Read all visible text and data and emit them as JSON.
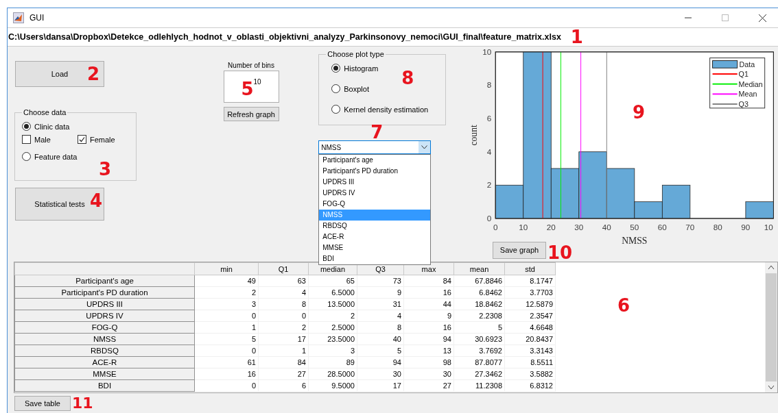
{
  "window": {
    "title": "GUI"
  },
  "path_bar": {
    "text": "C:\\Users\\dansa\\Dropbox\\Detekce_odlehlych_hodnot_v_oblasti_objektivni_analyzy_Parkinsonovy_nemoci\\GUI_final\\feature_matrix.xlsx",
    "callout": "1"
  },
  "load_button": {
    "label": "Load",
    "callout": "2"
  },
  "choose_data": {
    "title": "Choose data",
    "callout": "3",
    "options": [
      {
        "kind": "radio",
        "label": "Clinic data",
        "selected": true
      },
      {
        "kind": "checkbox",
        "label": "Male",
        "checked": false
      },
      {
        "kind": "checkbox",
        "label": "Female",
        "checked": true
      },
      {
        "kind": "radio",
        "label": "Feature data",
        "selected": false
      }
    ]
  },
  "stat_tests_button": {
    "label": "Statistical tests",
    "callout": "4"
  },
  "bins": {
    "label": "Number of bins",
    "value": "10",
    "callout": "5",
    "refresh_label": "Refresh graph"
  },
  "plot_type": {
    "title": "Choose plot type",
    "callout": "8",
    "options": [
      {
        "label": "Histogram",
        "selected": true
      },
      {
        "label": "Boxplot",
        "selected": false
      },
      {
        "label": "Kernel density estimation",
        "selected": false
      }
    ]
  },
  "variable_dropdown": {
    "value": "NMSS",
    "callout": "7",
    "expanded": true,
    "options": [
      {
        "label": "Participant's age",
        "selected": false
      },
      {
        "label": "Participant's PD duration",
        "selected": false
      },
      {
        "label": "UPDRS III",
        "selected": false
      },
      {
        "label": "UPDRS IV",
        "selected": false
      },
      {
        "label": "FOG-Q",
        "selected": false
      },
      {
        "label": "NMSS",
        "selected": true
      },
      {
        "label": "RBDSQ",
        "selected": false
      },
      {
        "label": "ACE-R",
        "selected": false
      },
      {
        "label": "MMSE",
        "selected": false
      },
      {
        "label": "BDI",
        "selected": false
      }
    ]
  },
  "graph": {
    "callout": "9",
    "save_label": "Save graph",
    "save_callout": "10",
    "chart_data": {
      "type": "bar",
      "xlabel": "NMSS",
      "ylabel": "count",
      "x": [
        5,
        15,
        25,
        35,
        45,
        55,
        65,
        75,
        85,
        95
      ],
      "series": [
        {
          "name": "Data",
          "color": "#65a9d7",
          "values": [
            2,
            10,
            3,
            4,
            3,
            1,
            2,
            0,
            0,
            1
          ]
        }
      ],
      "xlim": [
        0,
        100
      ],
      "ylim": [
        0,
        10
      ],
      "xticks": [
        0,
        10,
        20,
        30,
        40,
        50,
        60,
        70,
        80,
        90
      ],
      "yticks": [
        0,
        2,
        4,
        6,
        8,
        10
      ],
      "ref_lines": [
        {
          "axis": "x",
          "value": 17,
          "color": "#ff0000"
        },
        {
          "axis": "x",
          "value": 23.5,
          "color": "#00ee00"
        },
        {
          "axis": "x",
          "value": 30.6923,
          "color": "#ff00ff"
        },
        {
          "axis": "x",
          "value": 40,
          "color": "#808080"
        }
      ]
    },
    "cut_tick_label": "10",
    "legend": [
      {
        "label": "Q1",
        "color": "#ff0000"
      },
      {
        "label": "Median",
        "color": "#00ee00"
      },
      {
        "label": "Mean",
        "color": "#ff00ff"
      },
      {
        "label": "Q3",
        "color": "#808080"
      }
    ]
  },
  "table": {
    "callout": "6",
    "columns": [
      "min",
      "Q1",
      "median",
      "Q3",
      "max",
      "mean",
      "std"
    ],
    "rows": [
      {
        "name": "Participant's age",
        "cells": [
          "49",
          "63",
          "65",
          "73",
          "84",
          "67.8846",
          "8.1747"
        ]
      },
      {
        "name": "Participant's PD duration",
        "cells": [
          "2",
          "4",
          "6.5000",
          "9",
          "16",
          "6.8462",
          "3.7703"
        ]
      },
      {
        "name": "UPDRS III",
        "cells": [
          "3",
          "8",
          "13.5000",
          "31",
          "44",
          "18.8462",
          "12.5879"
        ]
      },
      {
        "name": "UPDRS IV",
        "cells": [
          "0",
          "0",
          "2",
          "4",
          "9",
          "2.2308",
          "2.3547"
        ]
      },
      {
        "name": "FOG-Q",
        "cells": [
          "1",
          "2",
          "2.5000",
          "8",
          "16",
          "5",
          "4.6648"
        ]
      },
      {
        "name": "NMSS",
        "cells": [
          "5",
          "17",
          "23.5000",
          "40",
          "94",
          "30.6923",
          "20.8437"
        ]
      },
      {
        "name": "RBDSQ",
        "cells": [
          "0",
          "1",
          "3",
          "5",
          "13",
          "3.7692",
          "3.3143"
        ]
      },
      {
        "name": "ACE-R",
        "cells": [
          "61",
          "84",
          "89",
          "94",
          "98",
          "87.8077",
          "8.5511"
        ]
      },
      {
        "name": "MMSE",
        "cells": [
          "16",
          "27",
          "28.5000",
          "30",
          "30",
          "27.3462",
          "3.5882"
        ]
      },
      {
        "name": "BDI",
        "cells": [
          "0",
          "6",
          "9.5000",
          "17",
          "27",
          "11.2308",
          "6.8312"
        ]
      }
    ]
  },
  "save_table": {
    "label": "Save table",
    "callout": "11"
  }
}
